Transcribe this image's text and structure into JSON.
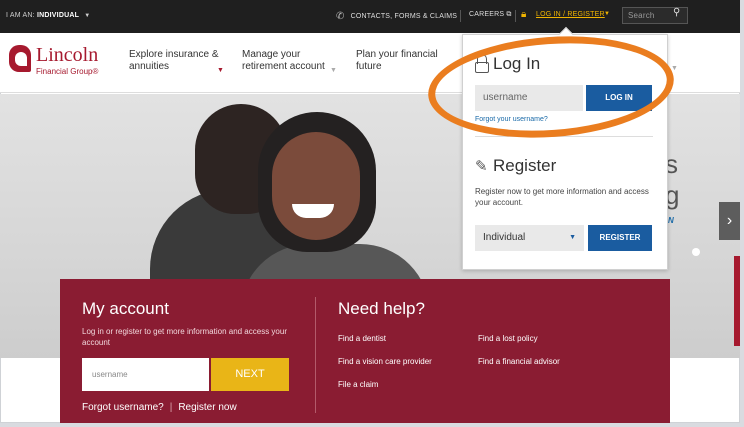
{
  "topbar": {
    "iam_prefix": "I AM AN:",
    "iam_value": "INDIVIDUAL",
    "contacts": "CONTACTS, FORMS & CLAIMS",
    "careers": "CAREERS",
    "login_register": "LOG IN / REGISTER",
    "search_placeholder": "Search"
  },
  "logo": {
    "name": "Lincoln",
    "sub": "Financial Group®"
  },
  "nav": {
    "items": [
      {
        "label": "Explore insurance & annuities"
      },
      {
        "label": "Manage your retirement account"
      },
      {
        "label": "Plan your financial future"
      }
    ]
  },
  "hero": {
    "partial_line1": "s",
    "partial_line2": "g",
    "partial_line3": "N"
  },
  "account": {
    "title": "My account",
    "description": "Log in or register to get more information and access your account",
    "username_placeholder": "username",
    "next_label": "NEXT",
    "forgot_label": "Forgot username?",
    "register_label": "Register now"
  },
  "help": {
    "title": "Need help?",
    "links": [
      "Find a dentist",
      "Find a vision care provider",
      "File a claim",
      "Find a lost policy",
      "Find a financial advisor"
    ]
  },
  "login_panel": {
    "title": "Log In",
    "username_placeholder": "username",
    "login_button": "LOG IN",
    "forgot": "Forgot your username?",
    "register_title": "Register",
    "register_desc": "Register now to get more information and access your account.",
    "select_value": "Individual",
    "register_button": "REGISTER"
  },
  "colors": {
    "brand_red": "#a6192e",
    "band_maroon": "#8a1c32",
    "link_blue": "#1a5ca0",
    "gold": "#e9b517",
    "annotation_orange": "#ea7d1f"
  }
}
